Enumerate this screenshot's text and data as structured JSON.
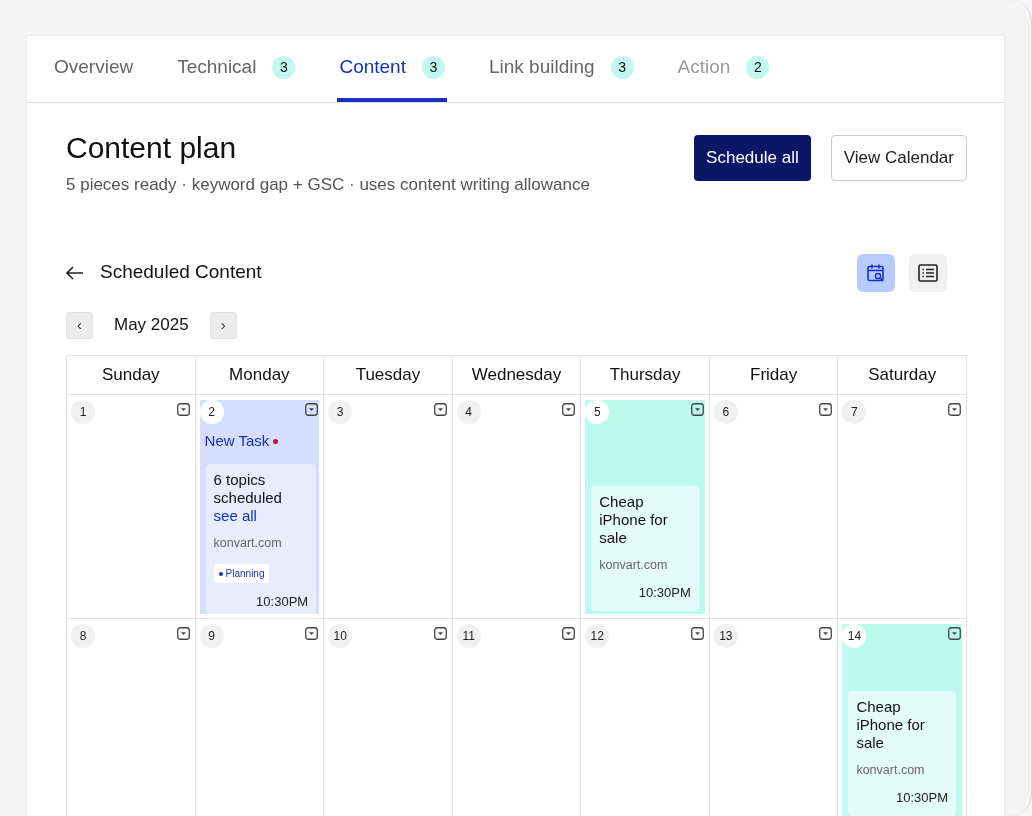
{
  "tabs": [
    {
      "label": "Overview",
      "selected": false,
      "disabled": false
    },
    {
      "label": "Technical",
      "count": "3",
      "selected": false,
      "disabled": false
    },
    {
      "label": "Content",
      "count": "3",
      "selected": true,
      "disabled": false
    },
    {
      "label": "Link building",
      "count": "3",
      "selected": false,
      "disabled": false
    },
    {
      "label": "Action",
      "count": "2",
      "selected": false,
      "disabled": true
    }
  ],
  "header": {
    "title": "Content plan",
    "subtitle": "5 pieces ready · keyword gap + GSC · uses content writing allowance",
    "buttons": [
      {
        "label": "Schedule all",
        "kind": "primary"
      },
      {
        "label": "View Calendar",
        "kind": "outline"
      }
    ]
  },
  "section": {
    "title": "Scheduled Content",
    "views": [
      {
        "kind": "calendar",
        "selected": true
      },
      {
        "kind": "list",
        "selected": false
      }
    ]
  },
  "month": {
    "label": "May 2025",
    "prev": "‹",
    "next": "›"
  },
  "calendar": {
    "weekdays": [
      "Sunday",
      "Monday",
      "Tuesday",
      "Wednesday",
      "Thursday",
      "Friday",
      "Saturday"
    ],
    "weeks": [
      [
        {
          "day": "1",
          "kind": "empty"
        },
        {
          "day": "2",
          "kind": "task",
          "color": "#d5dffd",
          "task": {
            "label": "New Task",
            "color": "#c8102e"
          },
          "summary": "6 topics scheduled",
          "link": "see all",
          "site": "konvart.com",
          "tag": "Planning",
          "time": "10:30PM"
        },
        {
          "day": "3",
          "kind": "empty"
        },
        {
          "day": "4",
          "kind": "empty"
        },
        {
          "day": "5",
          "kind": "post",
          "color": "#bdfaee",
          "title": "Cheap iPhone for sale",
          "site": "konvart.com",
          "time": "10:30PM"
        },
        {
          "day": "6",
          "kind": "empty"
        },
        {
          "day": "7",
          "kind": "empty"
        }
      ],
      [
        {
          "day": "8",
          "kind": "empty"
        },
        {
          "day": "9",
          "kind": "empty"
        },
        {
          "day": "10",
          "kind": "empty"
        },
        {
          "day": "11",
          "kind": "empty"
        },
        {
          "day": "12",
          "kind": "empty"
        },
        {
          "day": "13",
          "kind": "empty"
        },
        {
          "day": "14",
          "kind": "post",
          "color": "#bdfaee",
          "title": "Cheap iPhone for sale",
          "site": "konvart.com",
          "time": "10:30PM"
        }
      ]
    ]
  }
}
